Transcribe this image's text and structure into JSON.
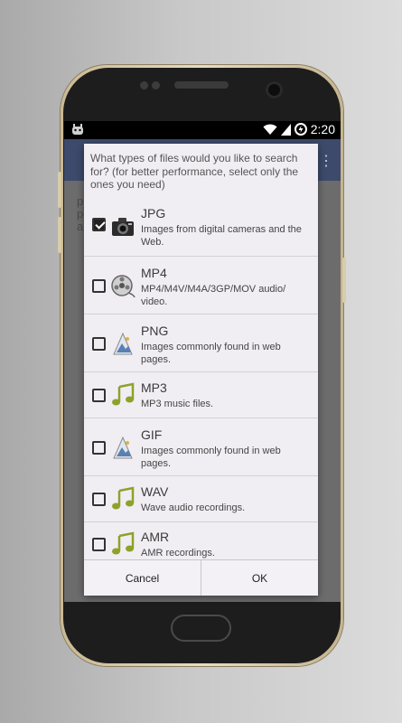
{
  "status_bar": {
    "time": "2:20"
  },
  "dialog": {
    "title": "What types of files would you like to search for? (for better performance, select only the ones you need)",
    "options": [
      {
        "title": "JPG",
        "desc": "Images from digital cameras and the Web.",
        "checked": true,
        "icon": "camera-icon"
      },
      {
        "title": "MP4",
        "desc": "MP4/M4V/M4A/3GP/MOV audio/ video.",
        "checked": false,
        "icon": "film-reel-icon"
      },
      {
        "title": "PNG",
        "desc": "Images commonly found in web pages.",
        "checked": false,
        "icon": "image-icon"
      },
      {
        "title": "MP3",
        "desc": "MP3 music files.",
        "checked": false,
        "icon": "music-note-icon"
      },
      {
        "title": "GIF",
        "desc": "Images commonly found in web pages.",
        "checked": false,
        "icon": "image-icon"
      },
      {
        "title": "WAV",
        "desc": "Wave audio recordings.",
        "checked": false,
        "icon": "music-note-icon"
      },
      {
        "title": "AMR",
        "desc": "AMR recordings.",
        "checked": false,
        "icon": "music-note-icon"
      }
    ],
    "cancel_label": "Cancel",
    "ok_label": "OK"
  },
  "colors": {
    "appbar": "#3d4a6b",
    "checkbox_checked": "#222222",
    "dialog_bg": "#f1eef3"
  }
}
